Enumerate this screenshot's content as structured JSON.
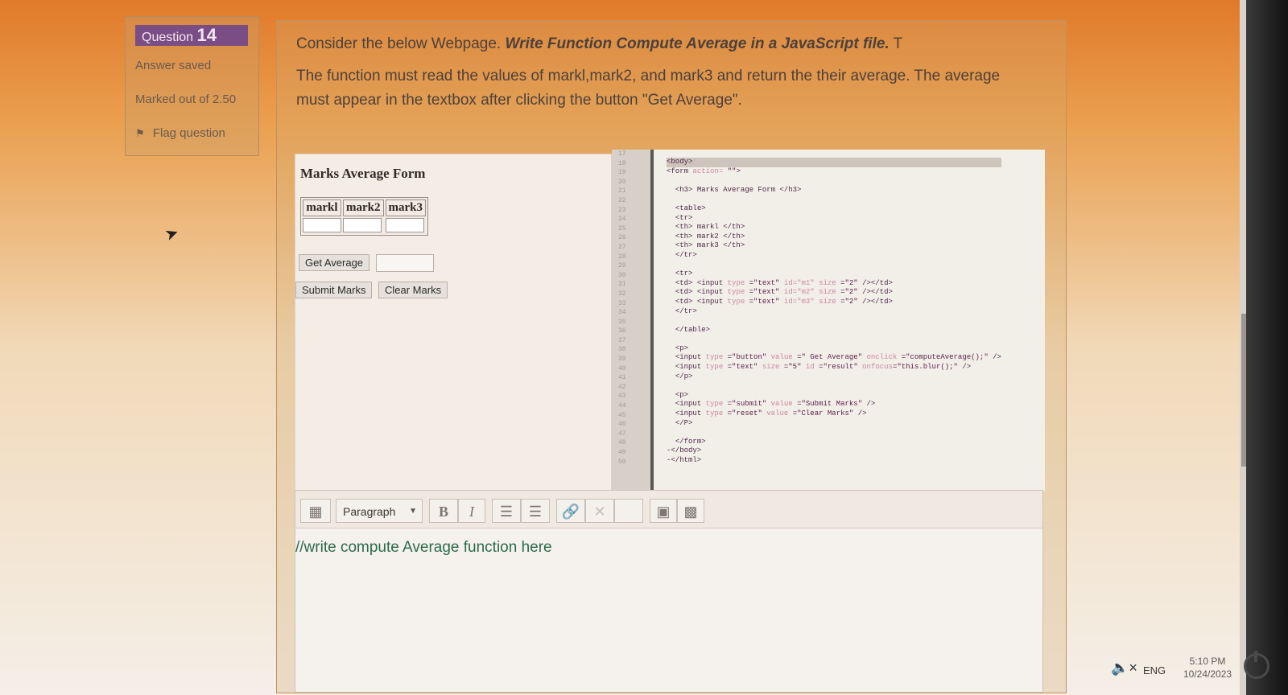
{
  "sidebar": {
    "question_label": "Question",
    "question_number": "14",
    "status": "Answer saved",
    "marked": "Marked out of 2.50",
    "flag": "Flag question"
  },
  "question": {
    "line1_plain": "Consider the below Webpage. ",
    "line1_bold": "Write Function Compute Average in a JavaScript file.",
    "line1_tail": " T",
    "line2": "The function must read the values of markl,mark2, and mark3 and return the their average. The average must appear in the textbox after clicking the button \"Get Average\"."
  },
  "preview": {
    "heading": "Marks Average Form",
    "headers": [
      "markl",
      "mark2",
      "mark3"
    ],
    "get_average": "Get Average",
    "submit": "Submit Marks",
    "clear": "Clear Marks"
  },
  "code": {
    "gutter": [
      "17",
      "18",
      "19",
      "20",
      "21",
      "22",
      "23",
      "24",
      "25",
      "26",
      "27",
      "28",
      "29",
      "30",
      "31",
      "32",
      "33",
      "34",
      "35",
      "36",
      "37",
      "38",
      "39",
      "40",
      "41",
      "42",
      "43",
      "44",
      "45",
      "46",
      "47",
      "48",
      "49",
      "50"
    ]
  },
  "editor": {
    "format": "Paragraph",
    "bold": "B",
    "italic": "I",
    "content": "//write compute Average function here"
  },
  "taskbar": {
    "lang": "ENG",
    "time": "5:10 PM",
    "date": "10/24/2023"
  }
}
